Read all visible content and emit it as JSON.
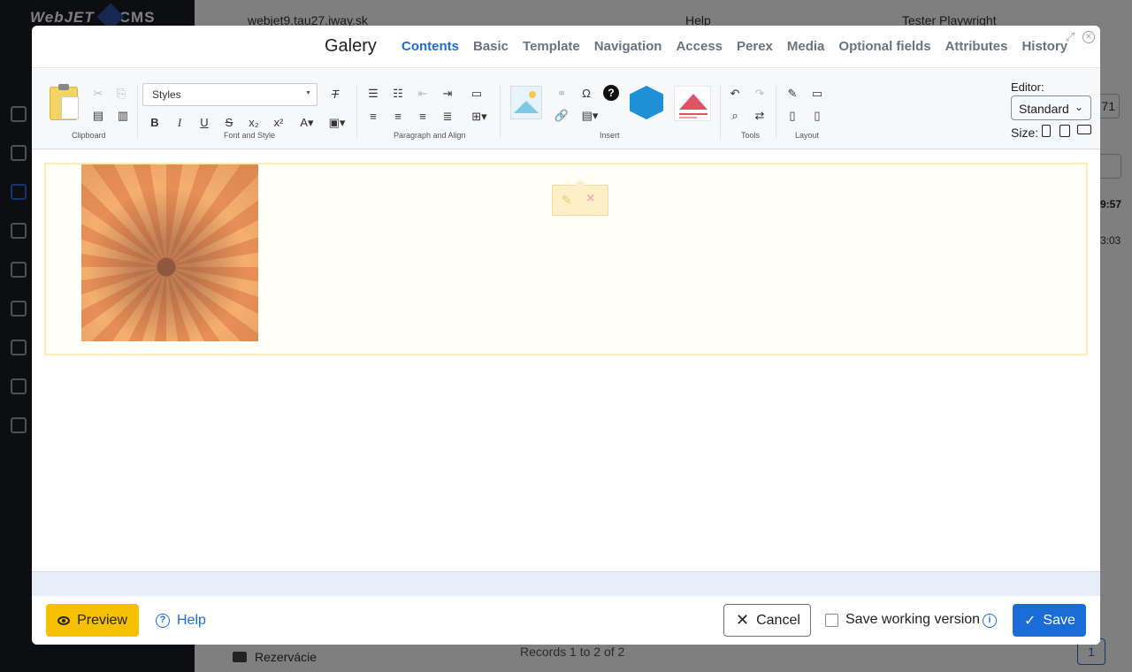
{
  "background": {
    "logo_text": "WebJET",
    "logo_cms": "CMS",
    "site": "webjet9.tau27.iway.sk",
    "help": "Help",
    "user": "Tester Playwright",
    "folder": "Rezervácie",
    "records": "Records 1 to 2 of 2",
    "page": "1",
    "frag_number": "71",
    "time1": "9:57",
    "time2": "3:03"
  },
  "modal": {
    "title": "Galery",
    "tabs": [
      "Contents",
      "Basic",
      "Template",
      "Navigation",
      "Access",
      "Perex",
      "Media",
      "Optional fields",
      "Attributes",
      "History"
    ],
    "active_tab": "Contents"
  },
  "toolbar": {
    "styles_placeholder": "Styles",
    "groups": {
      "clipboard": "Clipboard",
      "font_style": "Font and Style",
      "paragraph": "Paragraph and Align",
      "insert": "Insert",
      "tools": "Tools",
      "layout": "Layout"
    },
    "editor_label": "Editor:",
    "editor_value": "Standard",
    "size_label": "Size:"
  },
  "footer": {
    "preview": "Preview",
    "help": "Help",
    "cancel": "Cancel",
    "save_working": "Save working version",
    "save": "Save"
  },
  "colors": {
    "accent": "#1a6cd8",
    "preview_bg": "#f6c000",
    "block_border": "#fbecb9"
  }
}
